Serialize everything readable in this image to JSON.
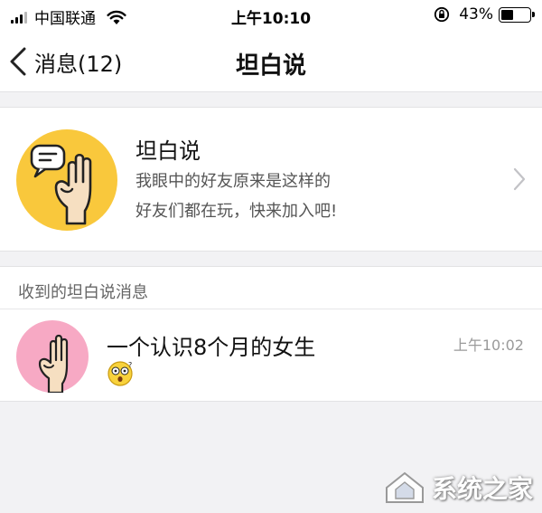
{
  "status_bar": {
    "carrier": "中国联通",
    "time": "上午10:10",
    "battery_percent": "43%",
    "battery_level": 0.43,
    "icons": [
      "signal-icon",
      "wifi-icon",
      "orientation-lock-icon",
      "battery-icon"
    ]
  },
  "nav": {
    "back_label": "消息(12)",
    "title": "坦白说"
  },
  "feature": {
    "title": "坦白说",
    "subtitle_line1": "我眼中的好友原来是这样的",
    "subtitle_line2": "好友们都在玩，快来加入吧!",
    "avatar_color": "#f9c83c",
    "icon": "raised-hand-speech-bubble-icon"
  },
  "section": {
    "label": "收到的坦白说消息"
  },
  "messages": [
    {
      "name": "一个认识8个月的女生",
      "time": "上午10:02",
      "preview_emoji": "shocked-face-icon",
      "avatar_color": "#f7a9c4"
    }
  ],
  "watermark": {
    "text": "系统之家"
  },
  "colors": {
    "background": "#f2f2f4",
    "divider": "#e2e2e4",
    "hand_skin": "#f6dfc1"
  }
}
